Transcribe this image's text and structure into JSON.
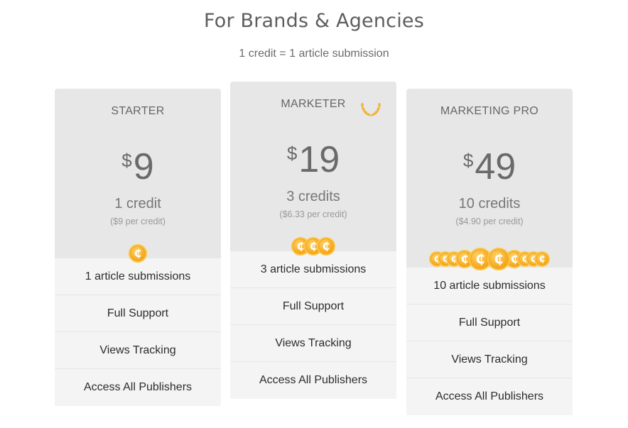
{
  "page": {
    "title": "For Brands & Agencies",
    "subtitle": "1 credit = 1 article submission"
  },
  "plans": [
    {
      "name": "STARTER",
      "currency": "$",
      "price": "9",
      "credits": "1 credit",
      "per_credit": "($9 per credit)",
      "coin_count": 1,
      "features": [
        "1 article submissions",
        "Full Support",
        "Views Tracking",
        "Access All Publishers"
      ]
    },
    {
      "name": "MARKETER",
      "currency": "$",
      "price": "19",
      "credits": "3 credits",
      "per_credit": "($6.33 per credit)",
      "coin_count": 3,
      "badge_icon": "laurel-wreath-icon",
      "features": [
        "3 article submissions",
        "Full Support",
        "Views Tracking",
        "Access All Publishers"
      ]
    },
    {
      "name": "MARKETING PRO",
      "currency": "$",
      "price": "49",
      "credits": "10 credits",
      "per_credit": "($4.90 per credit)",
      "coin_count": 10,
      "features": [
        "10 article submissions",
        "Full Support",
        "Views Tracking",
        "Access All Publishers"
      ]
    }
  ],
  "icons": {
    "coin": "credit-coin-icon",
    "coin_glyph": "₵"
  },
  "colors": {
    "coin": "#f4a417",
    "card_top": "#e7e7e7",
    "card_body": "#f4f4f4",
    "laurel": "#f0b53a"
  }
}
